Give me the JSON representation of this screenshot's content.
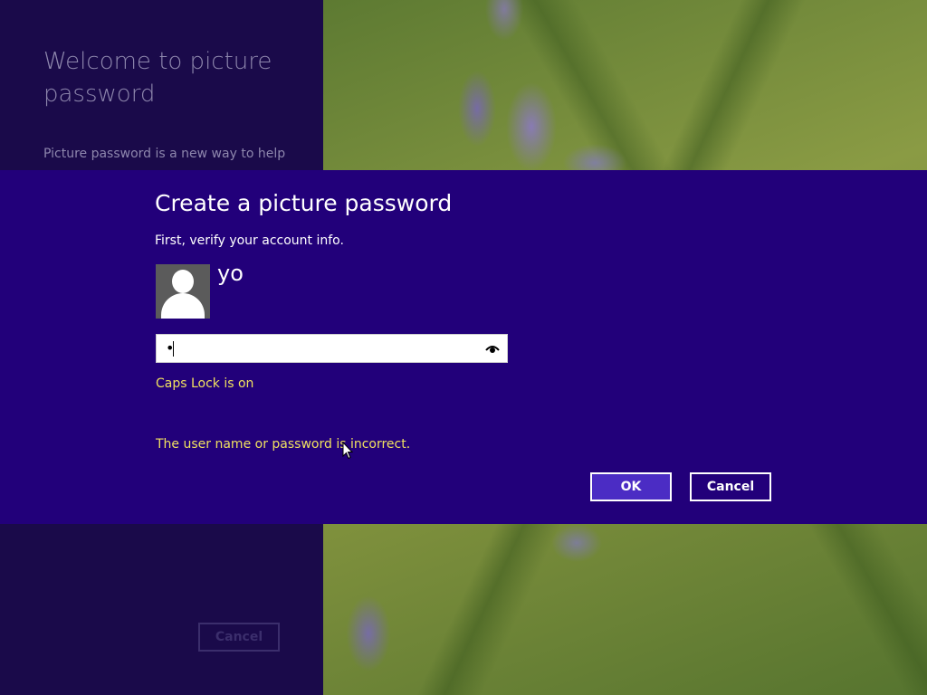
{
  "background": {
    "welcome_title": "Welcome to picture password",
    "welcome_text": "Picture password is a new way to help",
    "cancel_label": "Cancel"
  },
  "dialog": {
    "title": "Create a picture password",
    "subtitle": "First, verify your account info.",
    "username": "yo",
    "password_value": "•",
    "reveal_icon": "eye-icon",
    "caps_lock_message": "Caps Lock is on",
    "error_message": "The user name or password is incorrect.",
    "ok_label": "OK",
    "cancel_label": "Cancel"
  },
  "colors": {
    "dialog_bg": "#22007a",
    "panel_bg": "#1a0a4a",
    "ok_bg": "#4b2cc4",
    "warning_text": "#f0e060"
  }
}
